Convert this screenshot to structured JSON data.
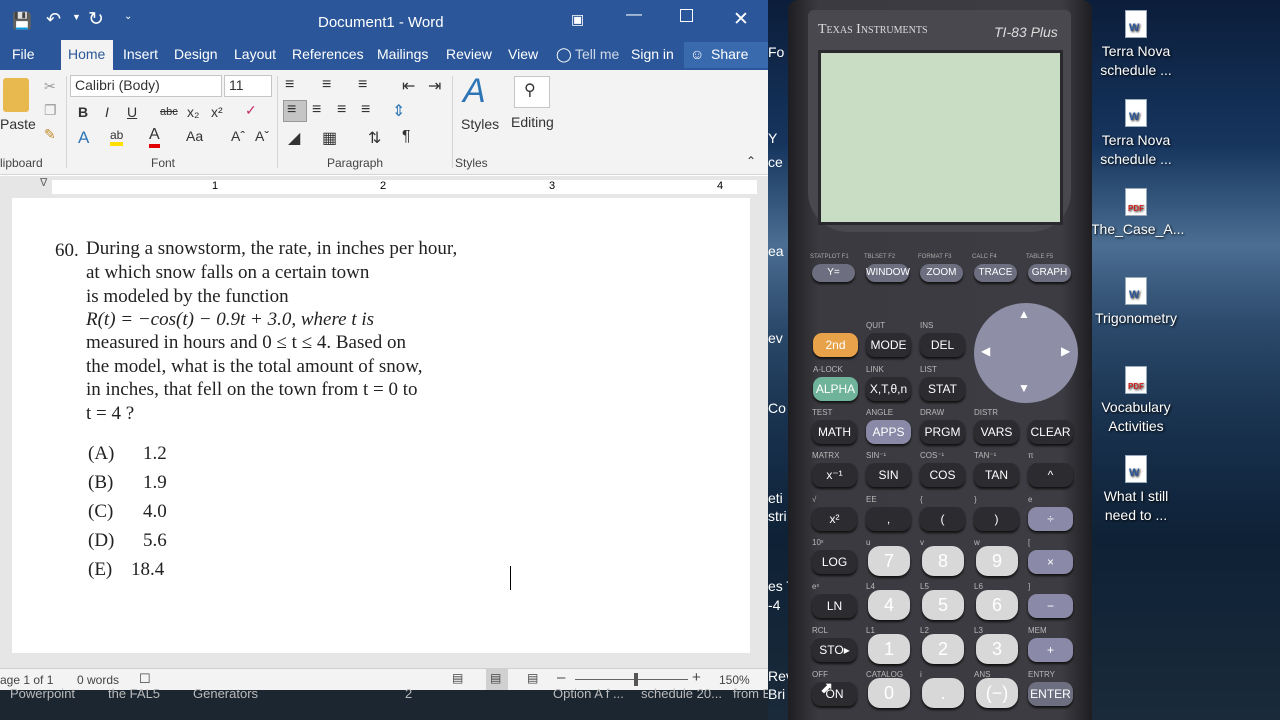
{
  "word": {
    "title": "Document1 - Word",
    "tabs": [
      "File",
      "Home",
      "Insert",
      "Design",
      "Layout",
      "References",
      "Mailings",
      "Review",
      "View"
    ],
    "tell_me": "Tell me",
    "sign_in": "Sign in",
    "share": "Share",
    "font_name": "Calibri (Body)",
    "font_size": "11",
    "groups": {
      "clipboard": "lipboard",
      "font": "Font",
      "paragraph": "Paragraph",
      "styles": "Styles"
    },
    "paste_label": "Paste",
    "styles_label": "Styles",
    "editing_label": "Editing",
    "ruler_marks": [
      "1",
      "2",
      "3",
      "4"
    ],
    "question": {
      "number": "60.",
      "lines": [
        "During a snowstorm, the rate, in inches per hour,",
        "at which snow falls on a certain town",
        "is modeled by the function",
        "R(t) = −cos(t) − 0.9t + 3.0,  where  t  is",
        "measured in hours and  0 ≤ t ≤ 4.  Based on",
        "the model, what is the total amount of snow,",
        "in inches, that fell on the town from  t = 0  to",
        "t = 4 ?"
      ],
      "choices": [
        {
          "label": "(A)",
          "value": "1.2"
        },
        {
          "label": "(B)",
          "value": "1.9"
        },
        {
          "label": "(C)",
          "value": "4.0"
        },
        {
          "label": "(D)",
          "value": "5.6"
        },
        {
          "label": "(E)",
          "value": "18.4"
        }
      ]
    },
    "status": {
      "page": "age 1 of 1",
      "words": "0 words",
      "zoom": "150%"
    }
  },
  "taskbar": {
    "items": [
      "Powerpoint",
      "the FAL5",
      "Generators",
      "2",
      "Option A f ...",
      "schedule 20...",
      "from Brit"
    ]
  },
  "desktop": {
    "icons": [
      {
        "label": "Terra Nova schedule ...",
        "type": "W"
      },
      {
        "label": "Terra Nova schedule ...",
        "type": "W"
      },
      {
        "label": "The_Case_A...",
        "type": "PDF"
      },
      {
        "label": "Trigonometry",
        "type": "W"
      },
      {
        "label": "Vocabulary Activities",
        "type": "PDF"
      },
      {
        "label": "What I still need to ...",
        "type": "W"
      }
    ],
    "left_strip": [
      "Fo",
      "Y",
      "ce",
      "ea",
      "ev",
      "Co",
      "eti",
      "stri",
      "es T",
      "-4",
      "Rev",
      "Bri"
    ]
  },
  "calculator": {
    "brand": "Texas Instruments",
    "model": "TI-83 Plus",
    "fn_labels": [
      "STATPLOT F1",
      "TBLSET F2",
      "FORMAT F3",
      "CALC F4",
      "TABLE F5"
    ],
    "fn_keys": [
      "Y=",
      "WINDOW",
      "ZOOM",
      "TRACE",
      "GRAPH"
    ],
    "keys": [
      {
        "label": "2nd",
        "above": ""
      },
      {
        "label": "MODE",
        "above": "QUIT"
      },
      {
        "label": "DEL",
        "above": "INS"
      },
      {
        "label": "ALPHA",
        "above": "A-LOCK"
      },
      {
        "label": "X,T,θ,n",
        "above": "LINK"
      },
      {
        "label": "STAT",
        "above": "LIST"
      },
      {
        "label": "MATH",
        "above": "TEST"
      },
      {
        "label": "APPS",
        "above": "ANGLE"
      },
      {
        "label": "PRGM",
        "above": "DRAW"
      },
      {
        "label": "VARS",
        "above": "DISTR"
      },
      {
        "label": "CLEAR",
        "above": ""
      },
      {
        "label": "x⁻¹",
        "above": "MATRX"
      },
      {
        "label": "SIN",
        "above": "SIN⁻¹"
      },
      {
        "label": "COS",
        "above": "COS⁻¹"
      },
      {
        "label": "TAN",
        "above": "TAN⁻¹"
      },
      {
        "label": "^",
        "above": "π"
      },
      {
        "label": "x²",
        "above": "√"
      },
      {
        "label": ",",
        "above": "EE"
      },
      {
        "label": "(",
        "above": "{"
      },
      {
        "label": ")",
        "above": "}"
      },
      {
        "label": "÷",
        "above": "e"
      },
      {
        "label": "LOG",
        "above": "10ˣ"
      },
      {
        "label": "7",
        "above": "u"
      },
      {
        "label": "8",
        "above": "v"
      },
      {
        "label": "9",
        "above": "w"
      },
      {
        "label": "×",
        "above": "["
      },
      {
        "label": "LN",
        "above": "eˣ"
      },
      {
        "label": "4",
        "above": "L4"
      },
      {
        "label": "5",
        "above": "L5"
      },
      {
        "label": "6",
        "above": "L6"
      },
      {
        "label": "−",
        "above": "]"
      },
      {
        "label": "STO▸",
        "above": "RCL"
      },
      {
        "label": "1",
        "above": "L1"
      },
      {
        "label": "2",
        "above": "L2"
      },
      {
        "label": "3",
        "above": "L3"
      },
      {
        "label": "+",
        "above": "MEM"
      },
      {
        "label": "ON",
        "above": "OFF"
      },
      {
        "label": "0",
        "above": "CATALOG"
      },
      {
        "label": ".",
        "above": "i"
      },
      {
        "label": "(−)",
        "above": "ANS"
      },
      {
        "label": "ENTER",
        "above": "ENTRY"
      }
    ]
  }
}
